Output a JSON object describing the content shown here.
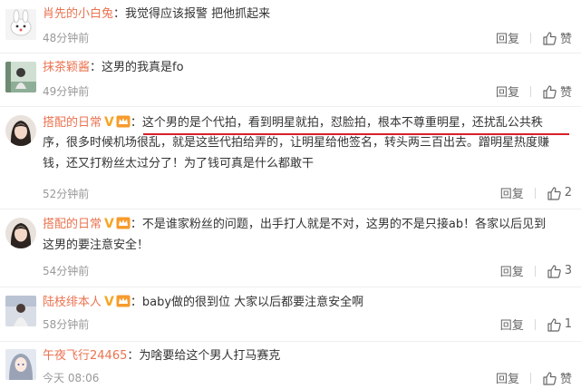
{
  "comments": [
    {
      "name": "肖先的小白兔",
      "separator": "：",
      "text": "我觉得应该报警 把他抓起来",
      "time": "48分钟前",
      "reply": "回复",
      "like": "赞",
      "verified": false,
      "vip": false
    },
    {
      "name": "抹茶颖酱",
      "separator": "：",
      "text": "这男的我真是fo",
      "time": "49分钟前",
      "reply": "回复",
      "like": "赞",
      "verified": false,
      "vip": false
    },
    {
      "name": "搭配的日常",
      "separator": "：",
      "text_lines": [
        "这个男的是个代拍，看到明星就拍，怼脸拍，根本不尊重明星，还扰乱公共秩",
        "序，很多时候机场很乱，就是这些代拍给弄的，让明星给他签名，转头两三百出去。蹭明星热度赚",
        "钱，还又打粉丝太过分了！为了钱可真是什么都敢干"
      ],
      "time": "52分钟前",
      "reply": "回复",
      "like": "2",
      "verified": true,
      "vip": true
    },
    {
      "name": "搭配的日常",
      "separator": "：",
      "text_lines": [
        "不是谁家粉丝的问题，出手打人就是不对，这男的不是只接ab！各家以后见到",
        "这男的要注意安全！"
      ],
      "time": "54分钟前",
      "reply": "回复",
      "like": "3",
      "verified": true,
      "vip": true
    },
    {
      "name": "陆枝绯本人",
      "separator": "：",
      "text": "baby做的很到位 大家以后都要注意安全啊",
      "time": "58分钟前",
      "reply": "回复",
      "like": "1",
      "verified": true,
      "vip": true
    },
    {
      "name": "午夜飞行24465",
      "separator": "：",
      "text": "为啥要给这个男人打马赛克",
      "time": "今天 08:06",
      "reply": "回复",
      "like": "赞",
      "verified": false,
      "vip": false
    }
  ],
  "colors": {
    "username": "#eb7350",
    "time": "#999999",
    "highlight_underline": "#d9202b",
    "verified_badge": "#f5a623"
  },
  "icons": {
    "like": "thumbs-up-icon",
    "verified": "verified-v-icon",
    "vip": "vip-crown-icon"
  }
}
